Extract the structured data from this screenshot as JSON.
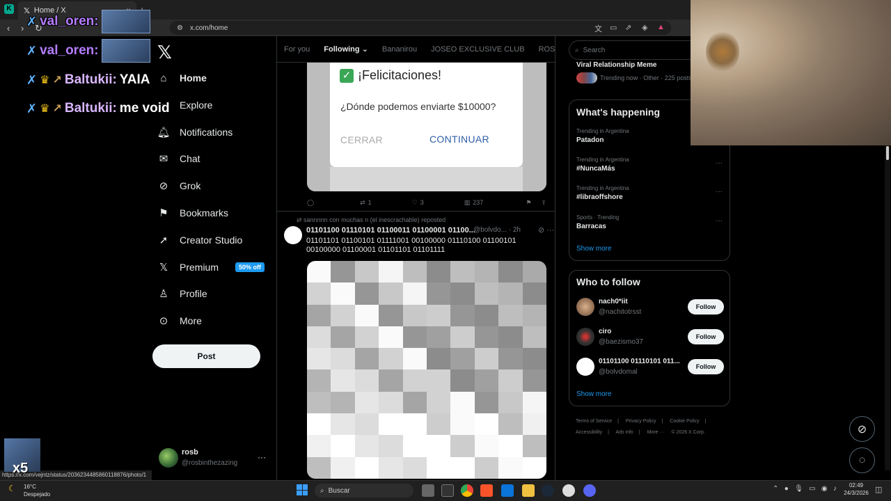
{
  "browser": {
    "tab_title": "Home / X",
    "tab_close": "×",
    "new_tab": "+",
    "url": "x.com/home",
    "status_url": "https://x.com/vejntz/status/2036234485860118876/photo/1"
  },
  "chat_overlay": {
    "lines": [
      {
        "user": "val_oren:",
        "message": ""
      },
      {
        "user": "val_oren:",
        "message": ""
      },
      {
        "user": "Baltukii:",
        "message": "YAIA"
      },
      {
        "user": "Baltukii:",
        "message": "me void"
      }
    ]
  },
  "sidebar": {
    "logo": "𝕏",
    "items": [
      {
        "label": "Home",
        "icon": "home-icon"
      },
      {
        "label": "Explore",
        "icon": "search-icon"
      },
      {
        "label": "Notifications",
        "icon": "bell-icon"
      },
      {
        "label": "Chat",
        "icon": "mail-icon"
      },
      {
        "label": "Grok",
        "icon": "grok-icon"
      },
      {
        "label": "Bookmarks",
        "icon": "bookmark-icon"
      },
      {
        "label": "Creator Studio",
        "icon": "rocket-icon"
      },
      {
        "label": "Premium",
        "icon": "x-logo-icon"
      },
      {
        "label": "Profile",
        "icon": "person-icon"
      },
      {
        "label": "More",
        "icon": "more-circle-icon"
      }
    ],
    "premium_badge": "50% off",
    "post_button": "Post",
    "account": {
      "name": "rosb",
      "handle": "@rosbinthezazing",
      "more": "···"
    }
  },
  "timeline": {
    "tabs": [
      "For you",
      "Following",
      "Bananirou",
      "JOSEO EXCLUSIVE CLUB",
      "ROSBISI"
    ],
    "active_tab": "Following",
    "post1": {
      "dialog_title": "¡Felicitaciones!",
      "dialog_question": "¿Dónde podemos enviarte $10000?",
      "dialog_cancel": "CERRAR",
      "dialog_continue": "CONTINUAR",
      "reposts": "1",
      "likes": "3",
      "views": "237"
    },
    "post2": {
      "repost_label": "sannnnn con muchas n (el inescrachable) reposted",
      "name": "01101100 01110101 01100011 01100001 01100...",
      "handle_time": "@bolvdo... · 2h",
      "text": "01101101 01100101 01111001 00100000 01110100 01100101 00100000 01100001 01101101 01101111"
    }
  },
  "right": {
    "search_placeholder": "Search",
    "viral": {
      "title": "Viral Relationship Meme",
      "sub": "Trending now · Other · 225 posts"
    },
    "whats_happening": {
      "title": "What's happening",
      "trends": [
        {
          "meta": "Trending in Argentina",
          "name": "Patadon"
        },
        {
          "meta": "Trending in Argentina",
          "name": "#NuncaMás"
        },
        {
          "meta": "Trending in Argentina",
          "name": "#libraoffshore"
        },
        {
          "meta": "Sports · Trending",
          "name": "Barracas"
        }
      ],
      "show_more": "Show more"
    },
    "who_to_follow": {
      "title": "Who to follow",
      "accounts": [
        {
          "name": "nach0*iit",
          "handle": "@nachitotrsst",
          "button": "Follow"
        },
        {
          "name": "ciro",
          "handle": "@baezismo37",
          "button": "Follow"
        },
        {
          "name": "01101100 01110101 011...",
          "handle": "@bolvdomal",
          "button": "Follow"
        }
      ],
      "show_more": "Show more"
    },
    "footer": [
      "Terms of Service",
      "|",
      "Privacy Policy",
      "|",
      "Cookie Policy",
      "|",
      "Accessibility",
      "|",
      "Ads info",
      "|",
      "More ···",
      "© 2026 X Corp."
    ]
  },
  "taskbar": {
    "temp": "16°C",
    "condition": "Despejado",
    "search": "Buscar",
    "time": "02:49",
    "date": "24/3/2026",
    "smallcam_label": "x5"
  },
  "colors": {
    "accent": "#1d9bf0",
    "background": "#000000"
  }
}
